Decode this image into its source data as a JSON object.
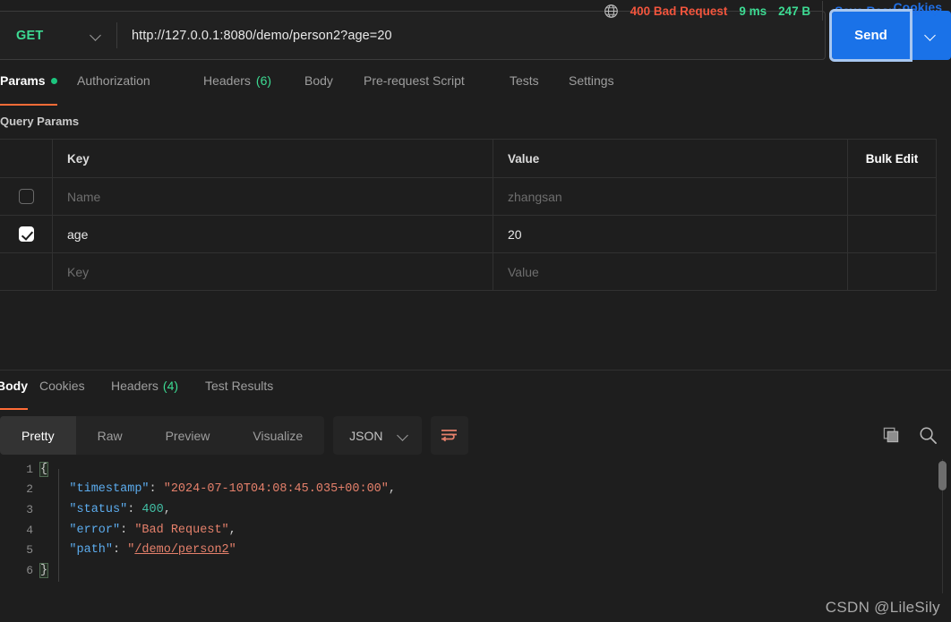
{
  "request": {
    "method": "GET",
    "url": "http://127.0.0.1:8080/demo/person2?age=20",
    "send_label": "Send"
  },
  "request_tabs": [
    {
      "label": "Params",
      "badge": "",
      "dot": true,
      "active": true
    },
    {
      "label": "Authorization",
      "badge": "",
      "dot": false,
      "active": false
    },
    {
      "label": "Headers",
      "badge": "(6)",
      "dot": false,
      "active": false
    },
    {
      "label": "Body",
      "badge": "",
      "dot": false,
      "active": false
    },
    {
      "label": "Pre-request Script",
      "badge": "",
      "dot": false,
      "active": false
    },
    {
      "label": "Tests",
      "badge": "",
      "dot": false,
      "active": false
    },
    {
      "label": "Settings",
      "badge": "",
      "dot": false,
      "active": false
    }
  ],
  "cookies_link": "Cookies",
  "query_params": {
    "title": "Query Params",
    "headers": {
      "key": "Key",
      "value": "Value",
      "bulk_edit": "Bulk Edit"
    },
    "rows": [
      {
        "checked": false,
        "key": "Name",
        "key_placeholder": true,
        "value": "zhangsan",
        "value_placeholder": true
      },
      {
        "checked": true,
        "key": "age",
        "key_placeholder": false,
        "value": "20",
        "value_placeholder": false
      },
      {
        "checked": null,
        "key": "Key",
        "key_placeholder": true,
        "value": "Value",
        "value_placeholder": true
      }
    ]
  },
  "response_tabs": [
    {
      "label": "Body",
      "badge": "",
      "active": true
    },
    {
      "label": "Cookies",
      "badge": "",
      "active": false
    },
    {
      "label": "Headers",
      "badge": "(4)",
      "active": false
    },
    {
      "label": "Test Results",
      "badge": "",
      "active": false
    }
  ],
  "response_meta": {
    "status": "400 Bad Request",
    "time": "9 ms",
    "size": "247 B",
    "save_label": "Save Response"
  },
  "body_toolbar": {
    "views": [
      {
        "label": "Pretty",
        "active": true
      },
      {
        "label": "Raw",
        "active": false
      },
      {
        "label": "Preview",
        "active": false
      },
      {
        "label": "Visualize",
        "active": false
      }
    ],
    "language": "JSON"
  },
  "response_body": {
    "lines": [
      {
        "n": "1",
        "tokens": [
          {
            "t": "{",
            "c": "brace bracehl"
          }
        ]
      },
      {
        "n": "2",
        "tokens": [
          {
            "t": "    ",
            "c": "p"
          },
          {
            "t": "\"timestamp\"",
            "c": "k"
          },
          {
            "t": ": ",
            "c": "p"
          },
          {
            "t": "\"2024-07-10T04:08:45.035+00:00\"",
            "c": "s"
          },
          {
            "t": ",",
            "c": "p"
          }
        ]
      },
      {
        "n": "3",
        "tokens": [
          {
            "t": "    ",
            "c": "p"
          },
          {
            "t": "\"status\"",
            "c": "k"
          },
          {
            "t": ": ",
            "c": "p"
          },
          {
            "t": "400",
            "c": "n"
          },
          {
            "t": ",",
            "c": "p"
          }
        ]
      },
      {
        "n": "4",
        "tokens": [
          {
            "t": "    ",
            "c": "p"
          },
          {
            "t": "\"error\"",
            "c": "k"
          },
          {
            "t": ": ",
            "c": "p"
          },
          {
            "t": "\"Bad Request\"",
            "c": "s"
          },
          {
            "t": ",",
            "c": "p"
          }
        ]
      },
      {
        "n": "5",
        "tokens": [
          {
            "t": "    ",
            "c": "p"
          },
          {
            "t": "\"path\"",
            "c": "k"
          },
          {
            "t": ": ",
            "c": "p"
          },
          {
            "t": "\"",
            "c": "s"
          },
          {
            "t": "/demo/person2",
            "c": "lnk"
          },
          {
            "t": "\"",
            "c": "s"
          }
        ]
      },
      {
        "n": "6",
        "tokens": [
          {
            "t": "}",
            "c": "brace bracehl"
          }
        ]
      }
    ]
  },
  "watermark": "CSDN @LileSily"
}
